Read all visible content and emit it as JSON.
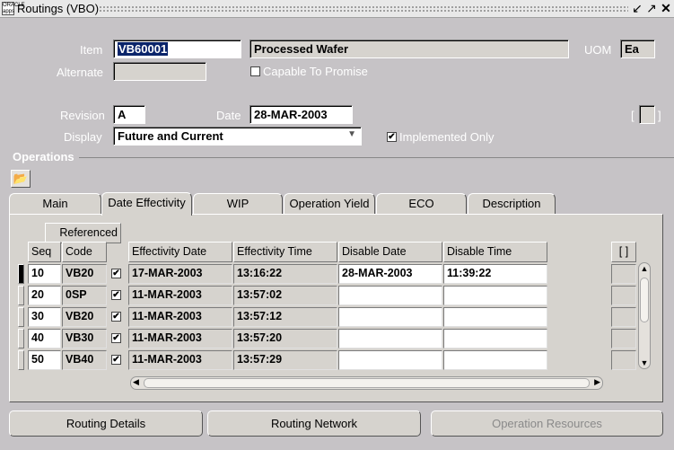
{
  "window": {
    "title": "Routings (VBO)"
  },
  "header": {
    "item_label": "Item",
    "item_value": "VB60001",
    "item_desc": "Processed Wafer",
    "uom_label": "UOM",
    "uom_value": "Ea",
    "alternate_label": "Alternate",
    "ctp_label": "Capable To Promise",
    "revision_label": "Revision",
    "revision_value": "A",
    "date_label": "Date",
    "date_value": "28-MAR-2003",
    "display_label": "Display",
    "display_value": "Future and Current",
    "implemented_label": "Implemented Only",
    "implemented_checked": true
  },
  "section_title": "Operations",
  "tabs": [
    "Main",
    "Date Effectivity",
    "WIP",
    "Operation Yield",
    "ECO",
    "Description"
  ],
  "active_tab": "Date Effectivity",
  "table": {
    "group_header": "Referenced",
    "columns": [
      "Seq",
      "Code",
      "Effectivity Date",
      "Effectivity Time",
      "Disable Date",
      "Disable Time"
    ],
    "flex_header": "[ ]",
    "rows": [
      {
        "seq": "10",
        "code": "VB20",
        "referenced": true,
        "eff_date": "17-MAR-2003",
        "eff_time": "13:16:22",
        "dis_date": "28-MAR-2003",
        "dis_time": "11:39:22"
      },
      {
        "seq": "20",
        "code": "0SP",
        "referenced": true,
        "eff_date": "11-MAR-2003",
        "eff_time": "13:57:02",
        "dis_date": "",
        "dis_time": ""
      },
      {
        "seq": "30",
        "code": "VB20",
        "referenced": true,
        "eff_date": "11-MAR-2003",
        "eff_time": "13:57:12",
        "dis_date": "",
        "dis_time": ""
      },
      {
        "seq": "40",
        "code": "VB30",
        "referenced": true,
        "eff_date": "11-MAR-2003",
        "eff_time": "13:57:20",
        "dis_date": "",
        "dis_time": ""
      },
      {
        "seq": "50",
        "code": "VB40",
        "referenced": true,
        "eff_date": "11-MAR-2003",
        "eff_time": "13:57:29",
        "dis_date": "",
        "dis_time": ""
      }
    ]
  },
  "buttons": {
    "routing_details": "Routing Details",
    "routing_network": "Routing Network",
    "operation_resources": "Operation Resources"
  },
  "icons": {
    "check": "✔",
    "folder": "folder-icon"
  }
}
